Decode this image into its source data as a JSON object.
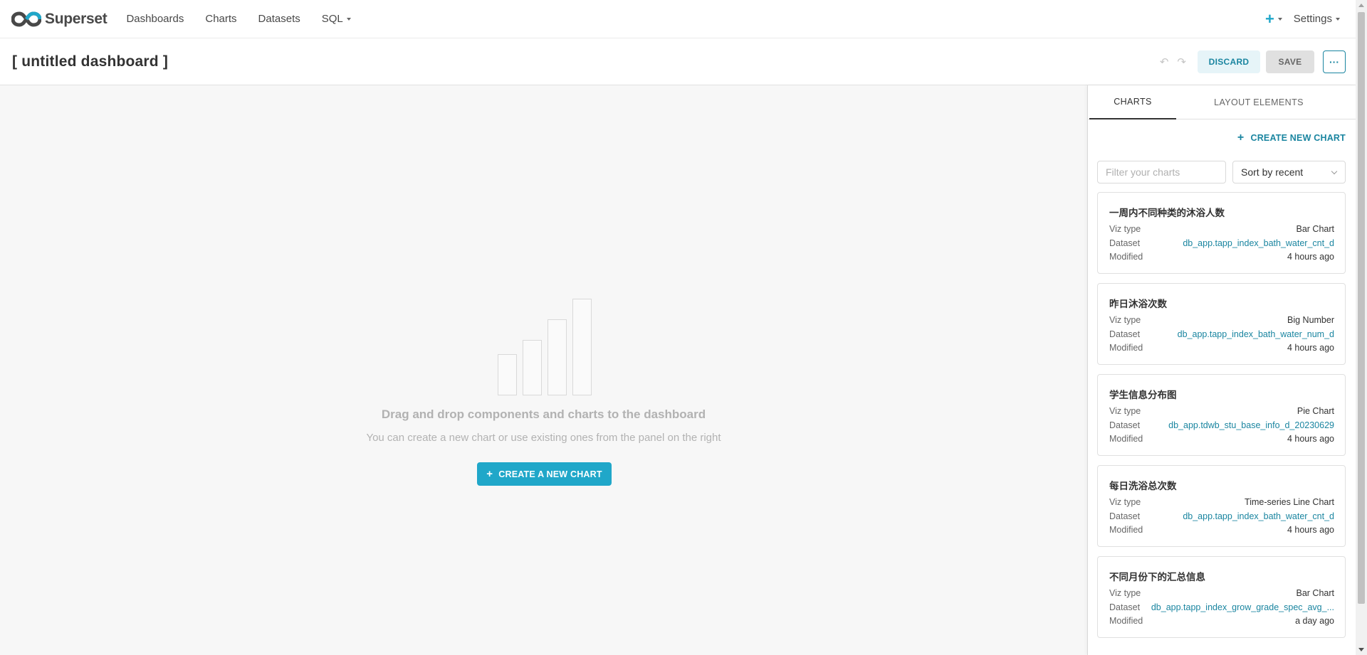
{
  "nav": {
    "brand": "Superset",
    "items": [
      {
        "label": "Dashboards"
      },
      {
        "label": "Charts"
      },
      {
        "label": "Datasets"
      },
      {
        "label": "SQL"
      }
    ],
    "plus_icon": "plus-icon",
    "settings_label": "Settings"
  },
  "header": {
    "title": "[ untitled dashboard ]",
    "discard_label": "DISCARD",
    "save_label": "SAVE",
    "more_label": "···"
  },
  "empty_state": {
    "title": "Drag and drop components and charts to the dashboard",
    "subtitle": "You can create a new chart or use existing ones from the panel on the right",
    "create_label": "CREATE A NEW CHART"
  },
  "panel": {
    "tabs": [
      {
        "label": "CHARTS",
        "active": true
      },
      {
        "label": "LAYOUT ELEMENTS",
        "active": false
      }
    ],
    "create_link": "CREATE NEW CHART",
    "filter_placeholder": "Filter your charts",
    "sort_value": "Sort by recent",
    "row_labels": {
      "viz": "Viz type",
      "dataset": "Dataset",
      "modified": "Modified"
    },
    "cards": [
      {
        "title": "一周内不同种类的沐浴人数",
        "viz_type": "Bar Chart",
        "dataset": "db_app.tapp_index_bath_water_cnt_d",
        "modified": "4 hours ago"
      },
      {
        "title": "昨日沐浴次数",
        "viz_type": "Big Number",
        "dataset": "db_app.tapp_index_bath_water_num_d",
        "modified": "4 hours ago"
      },
      {
        "title": "学生信息分布图",
        "viz_type": "Pie Chart",
        "dataset": "db_app.tdwb_stu_base_info_d_20230629",
        "modified": "4 hours ago"
      },
      {
        "title": "每日洗浴总次数",
        "viz_type": "Time-series Line Chart",
        "dataset": "db_app.tapp_index_bath_water_cnt_d",
        "modified": "4 hours ago"
      },
      {
        "title": "不同月份下的汇总信息",
        "viz_type": "Bar Chart",
        "dataset": "db_app.tapp_index_grow_grade_spec_avg_...",
        "modified": "a day ago"
      }
    ]
  },
  "colors": {
    "primary": "#20a7c9",
    "primary_dark": "#1a85a0",
    "canvas_bg": "#f7f7f7"
  }
}
